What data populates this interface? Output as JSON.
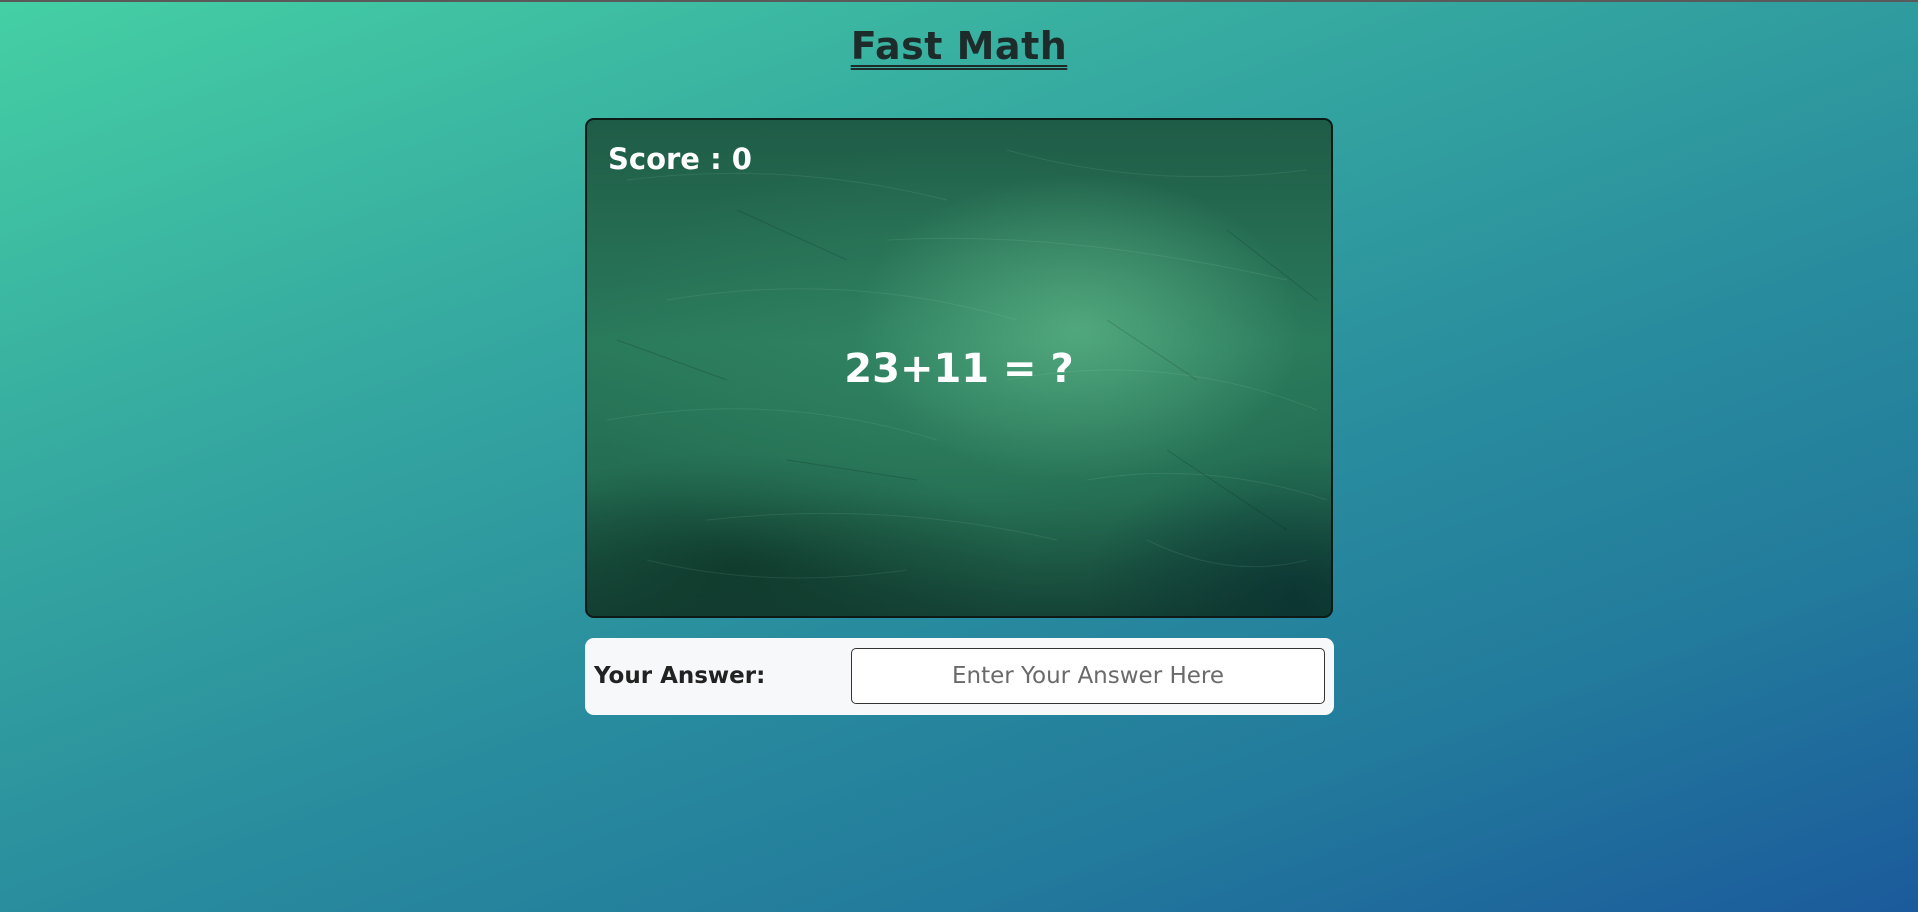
{
  "app": {
    "title": "Fast Math"
  },
  "board": {
    "score_label": "Score : 0",
    "question": "23+11 = ?"
  },
  "answer": {
    "label": "Your Answer:",
    "placeholder": "Enter Your Answer Here",
    "value": ""
  },
  "colors": {
    "background_start": "#45d0a4",
    "background_end": "#1b5a9c",
    "chalkboard": "#2a7a5c",
    "title_text": "#1d2b2b",
    "board_text": "#ffffff",
    "answer_panel": "#f7f8f9"
  }
}
